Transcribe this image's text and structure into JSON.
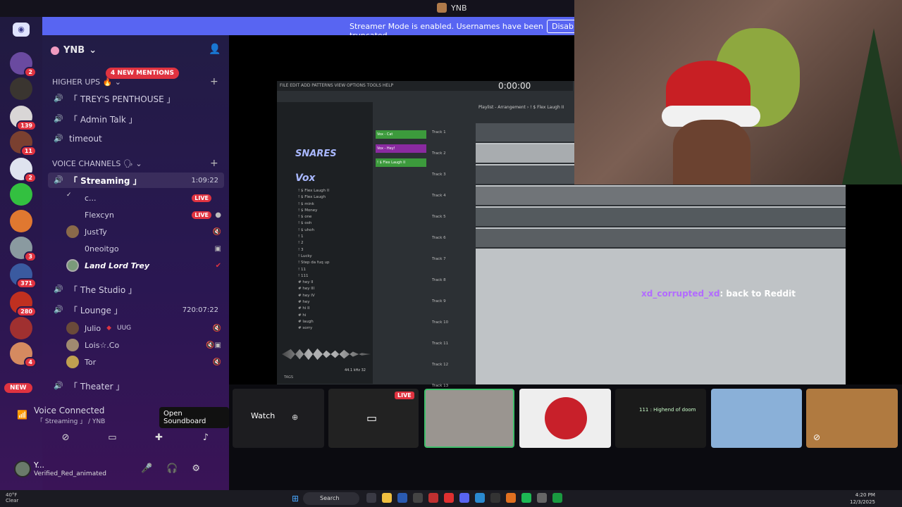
{
  "titlebar": {
    "title": "YNB"
  },
  "banner": {
    "text": "Streamer Mode is enabled. Usernames have been truncated.",
    "disable": "Disable"
  },
  "server": {
    "name": "YNB",
    "mentions": "4 NEW MENTIONS"
  },
  "rail": {
    "new_label": "NEW",
    "badges": [
      "2",
      "139",
      "11",
      "2",
      "3",
      "371",
      "280",
      "4"
    ]
  },
  "categories": {
    "higher_ups": "HIGHER UPS",
    "voice_channels": "VOICE CHANNELS"
  },
  "channels": {
    "trey_penthouse": "「 TREY'S PENTHOUSE 」",
    "admin_talk": "「 Admin Talk 」",
    "timeout": "timeout",
    "streaming": "「 Streaming 」",
    "streaming_time": "1:09:22",
    "studio": "「 The Studio 」",
    "lounge": "「 Lounge 」",
    "lounge_time": "720:07:22",
    "theater": "「 Theater 」"
  },
  "streaming_users": [
    {
      "name": "c...",
      "live": "LIVE"
    },
    {
      "name": "Flexcyn",
      "live": "LIVE"
    },
    {
      "name": "JustTy"
    },
    {
      "name": "0neoitgo"
    },
    {
      "name": "Land Lord Trey"
    }
  ],
  "lounge_users": [
    {
      "name": "Julio",
      "tag": "UUG"
    },
    {
      "name": "Lois☆.Co"
    },
    {
      "name": "Tor"
    }
  ],
  "voice": {
    "connected": "Voice Connected",
    "channel": "「 Streaming 」 / YNB",
    "tooltip": "Open Soundboard"
  },
  "userpanel": {
    "name": "Y...",
    "status": "Verified_Red_animated"
  },
  "stage": {
    "clock": "0:00:00",
    "playlist_title": "Playlist - Arrangement › ! $ Flex Laugh II",
    "snares": "SNARES",
    "vox": "Vox",
    "browser_files": [
      "! $ Flex Laugh II",
      "! $ Flex Laugh",
      "! $ mink",
      "! $ Money",
      "! $ one",
      "! $ ooh",
      "! $ uhoh",
      "! 1",
      "! 2",
      "! 3",
      "! Lucky",
      "! Step da fuq up",
      "! 11",
      "! 111",
      "# hey II",
      "# hey III",
      "# hey IV",
      "# hey",
      "# hi II",
      "# hi",
      "# laugh",
      "# sorry"
    ],
    "channel_rack": [
      "Vox - Cat",
      "Vox - Hey!",
      "! $ Flex Laugh II"
    ],
    "tracks": [
      "Track 1",
      "Track 2",
      "Track 3",
      "Track 4",
      "Track 5",
      "Track 6",
      "Track 7",
      "Track 8",
      "Track 9",
      "Track 10",
      "Track 11",
      "Track 12",
      "Track 13"
    ],
    "tags_label": "TAGS",
    "sample_rate": "44.1 kHz 32"
  },
  "chat": {
    "user": "xd_corrupted_xd",
    "text": ": back to Reddit"
  },
  "tiles": {
    "watch": "Watch",
    "live": "LIVE",
    "tile5_caption": "111 : Highend of doom"
  },
  "taskbar": {
    "temp": "40°F",
    "cond": "Clear",
    "search": "Search",
    "time": "4:20 PM",
    "date": "12/3/2025"
  },
  "colors": {
    "blurple": "#5865f2",
    "live_red": "#e03340",
    "accent_green": "#3fbf6a"
  }
}
